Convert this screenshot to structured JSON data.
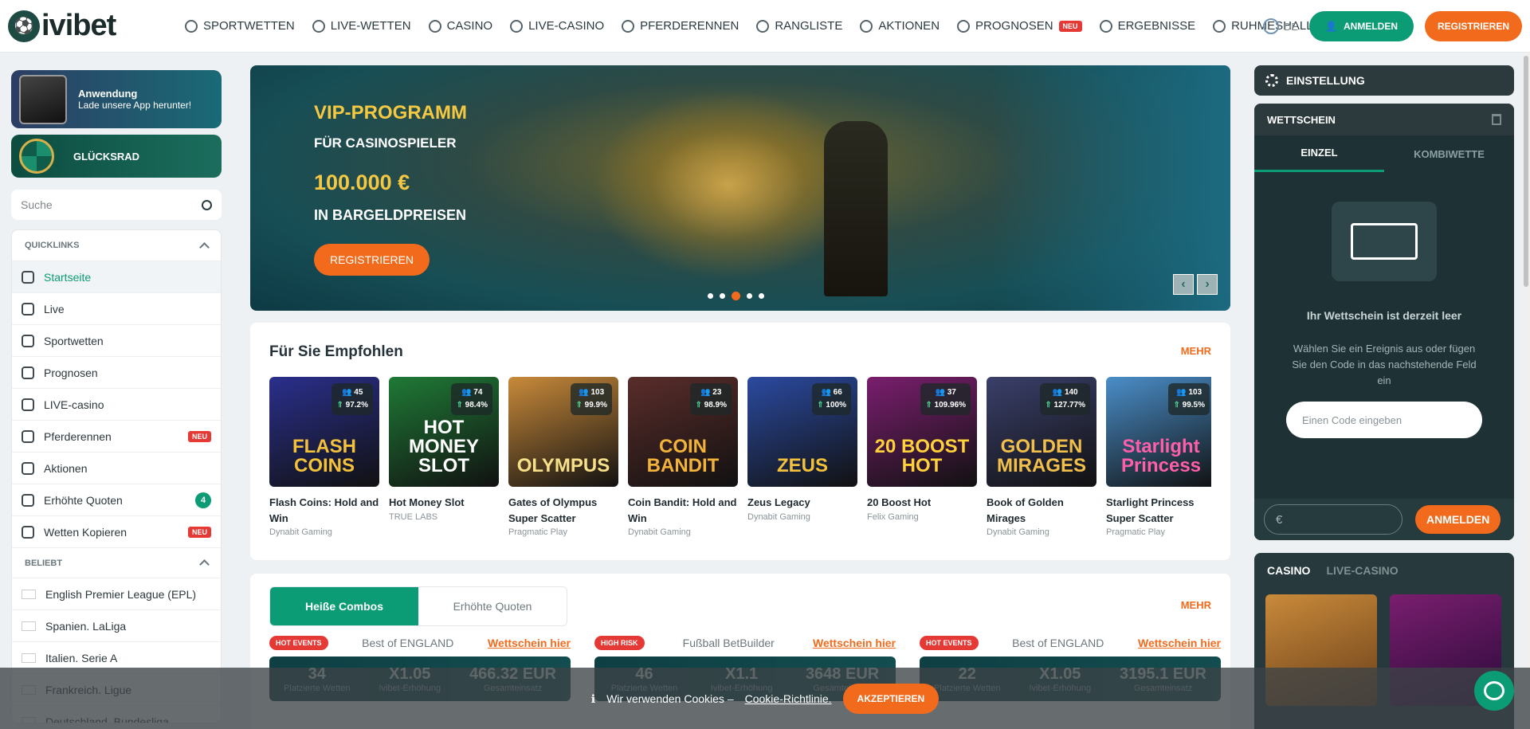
{
  "header": {
    "brand": "ivibet",
    "lang": "DE",
    "login": "ANMELDEN",
    "register": "REGISTRIEREN",
    "nav": [
      {
        "label": "SPORTWETTEN"
      },
      {
        "label": "LIVE-WETTEN"
      },
      {
        "label": "CASINO"
      },
      {
        "label": "LIVE-CASINO"
      },
      {
        "label": "PFERDERENNEN"
      },
      {
        "label": "RANGLISTE"
      },
      {
        "label": "AKTIONEN"
      },
      {
        "label": "PROGNOSEN",
        "badge": "NEU"
      },
      {
        "label": "ERGEBNISSE"
      },
      {
        "label": "RUHMESHALLE"
      }
    ]
  },
  "sidebar": {
    "app_title": "Anwendung",
    "app_sub": "Lade unsere App herunter!",
    "wheel": "GLÜCKSRAD",
    "search_placeholder": "Suche",
    "quicklinks_title": "QUICKLINKS",
    "quicklinks": [
      {
        "label": "Startseite"
      },
      {
        "label": "Live"
      },
      {
        "label": "Sportwetten"
      },
      {
        "label": "Prognosen"
      },
      {
        "label": "LIVE-casino"
      },
      {
        "label": "Pferderennen",
        "tag": "NEU"
      },
      {
        "label": "Aktionen"
      },
      {
        "label": "Erhöhte Quoten",
        "count": "4"
      },
      {
        "label": "Wetten Kopieren",
        "tag": "NEU"
      }
    ],
    "popular_title": "BELIEBT",
    "popular": [
      {
        "label": "English Premier League (EPL)"
      },
      {
        "label": "Spanien. LaLiga"
      },
      {
        "label": "Italien. Serie A"
      },
      {
        "label": "Frankreich. Ligue"
      },
      {
        "label": "Deutschland. Bundesliga"
      }
    ]
  },
  "banner": {
    "line1": "VIP-PROGRAMM",
    "line2": "FÜR CASINOSPIELER",
    "line3": "100.000 €",
    "line4": "IN BARGELDPREISEN",
    "cta": "REGISTRIEREN"
  },
  "recommended": {
    "title": "Für Sie Empfohlen",
    "more": "MEHR",
    "games": [
      {
        "title": "Flash Coins: Hold and Win",
        "provider": "Dynabit Gaming",
        "players": "45",
        "rtp": "97.2%",
        "art": "FLASH COINS",
        "bg": "#2a2f8c",
        "fg": "#f3c23a"
      },
      {
        "title": "Hot Money Slot",
        "provider": "TRUE LABS",
        "players": "74",
        "rtp": "98.4%",
        "art": "HOT MONEY SLOT",
        "bg": "#1f7a36",
        "fg": "#ffffff"
      },
      {
        "title": "Gates of Olympus Super Scatter",
        "provider": "Pragmatic Play",
        "players": "103",
        "rtp": "99.9%",
        "art": "OLYMPUS",
        "bg": "#c98a3a",
        "fg": "#f7e08a"
      },
      {
        "title": "Coin Bandit: Hold and Win",
        "provider": "Dynabit Gaming",
        "players": "23",
        "rtp": "98.9%",
        "art": "COIN BANDIT",
        "bg": "#5a2d2a",
        "fg": "#f2b33a"
      },
      {
        "title": "Zeus Legacy",
        "provider": "Dynabit Gaming",
        "players": "66",
        "rtp": "100%",
        "art": "ZEUS",
        "bg": "#2b4aa0",
        "fg": "#f3c23a"
      },
      {
        "title": "20 Boost Hot",
        "provider": "Felix Gaming",
        "players": "37",
        "rtp": "109.96%",
        "art": "20 BOOST HOT",
        "bg": "#7a1e6e",
        "fg": "#ffd23a"
      },
      {
        "title": "Book of Golden Mirages",
        "provider": "Dynabit Gaming",
        "players": "140",
        "rtp": "127.77%",
        "art": "GOLDEN MIRAGES",
        "bg": "#3a3f6a",
        "fg": "#f2c04a"
      },
      {
        "title": "Starlight Princess Super Scatter",
        "provider": "Pragmatic Play",
        "players": "103",
        "rtp": "99.5%",
        "art": "Starlight Princess",
        "bg": "#4a8ec9",
        "fg": "#ff5fa8"
      }
    ]
  },
  "combos": {
    "tab_active": "Heiße Combos",
    "tab_other": "Erhöhte Quoten",
    "more": "MEHR",
    "cards": [
      {
        "label": "HOT EVENTS",
        "color": "#e53935",
        "title": "Best of ENGLAND",
        "link": "Wettschein hier",
        "v1": "34",
        "l1": "Platzierte Wetten",
        "v2": "X1.05",
        "l2": "Ivibet-Erhöhung",
        "v3": "466.32 EUR",
        "l3": "Gesamteinsatz"
      },
      {
        "label": "HIGH RISK",
        "color": "#e53935",
        "title": "Fußball BetBuilder",
        "link": "Wettschein hier",
        "v1": "46",
        "l1": "Platzierte Wetten",
        "v2": "X1.1",
        "l2": "Ivibet-Erhöhung",
        "v3": "3648 EUR",
        "l3": "Gesamteinsatz"
      },
      {
        "label": "HOT EVENTS",
        "color": "#e53935",
        "title": "Best of ENGLAND",
        "link": "Wettschein hier",
        "v1": "22",
        "l1": "Platzierte Wetten",
        "v2": "X1.05",
        "l2": "Ivibet-Erhöhung",
        "v3": "3195.1 EUR",
        "l3": "Gesamteinsatz"
      }
    ]
  },
  "right": {
    "settings": "EINSTELLUNG",
    "slip_title": "WETTSCHEIN",
    "tab_single": "EINZEL",
    "tab_combo": "KOMBIWETTE",
    "empty": "Ihr Wettschein ist derzeit leer",
    "hint": "Wählen Sie ein Ereignis aus oder fügen Sie den Code in das nachstehende Feld ein",
    "code_placeholder": "Einen Code eingeben",
    "currency": "€",
    "login": "ANMELDEN",
    "casino_tab": "CASINO",
    "live_casino_tab": "LIVE-CASINO"
  },
  "cookie": {
    "text": "Wir verwenden Cookies –",
    "link": "Cookie-Richtlinie.",
    "accept": "AKZEPTIEREN"
  }
}
